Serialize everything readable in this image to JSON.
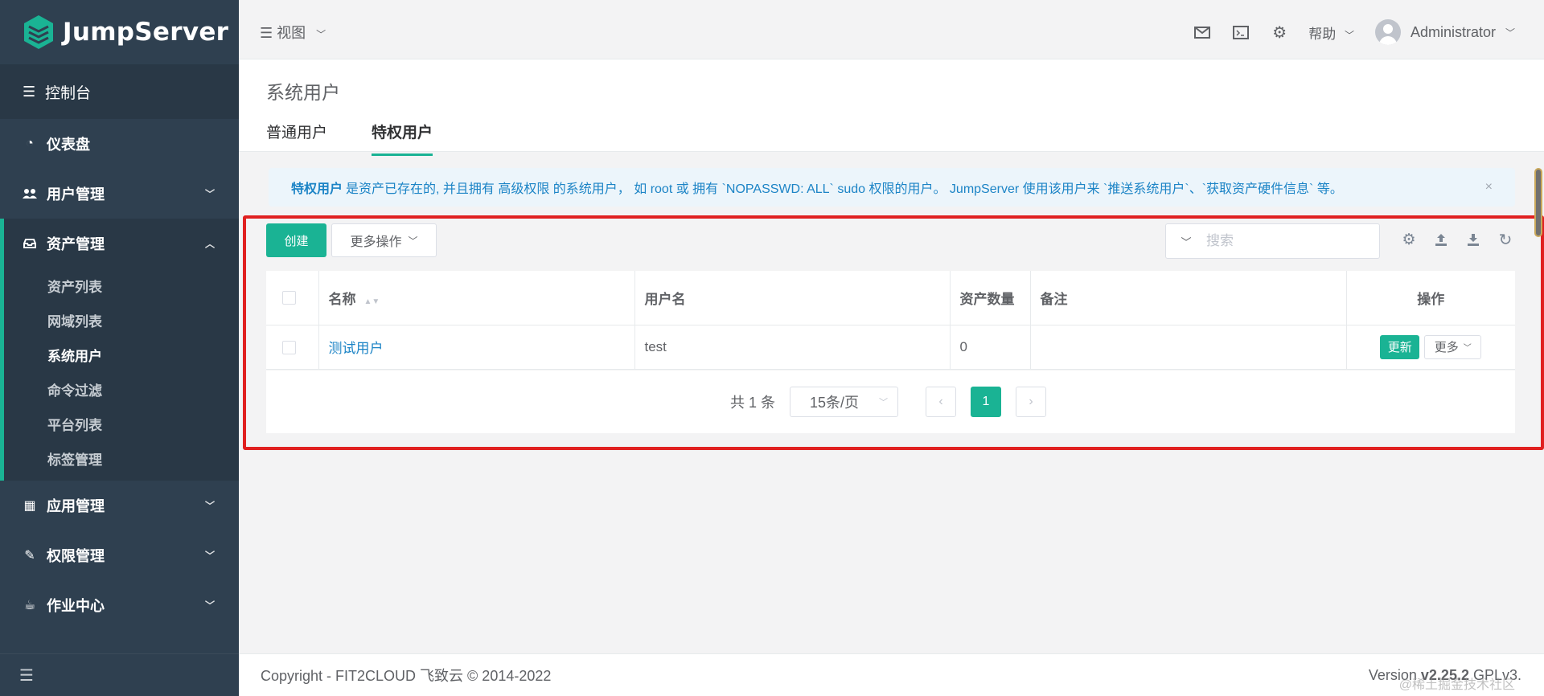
{
  "brand": {
    "name": "JumpServer"
  },
  "sidebar": {
    "console_label": "控制台",
    "items": [
      {
        "label": "仪表盘",
        "icon": "dashboard-icon"
      },
      {
        "label": "用户管理",
        "icon": "users-icon"
      },
      {
        "label": "资产管理",
        "icon": "inbox-icon"
      },
      {
        "label": "应用管理",
        "icon": "grid-icon"
      },
      {
        "label": "权限管理",
        "icon": "edit-icon"
      },
      {
        "label": "作业中心",
        "icon": "coffee-icon"
      }
    ],
    "sub_items": [
      "资产列表",
      "网域列表",
      "系统用户",
      "命令过滤",
      "平台列表",
      "标签管理"
    ]
  },
  "topbar": {
    "view_label": "视图",
    "help_label": "帮助",
    "user_name": "Administrator"
  },
  "page": {
    "title": "系统用户",
    "tabs": [
      "普通用户",
      "特权用户"
    ]
  },
  "alert": {
    "bold": "特权用户",
    "text": "是资产已存在的, 并且拥有 高级权限 的系统用户， 如 root 或 拥有 `NOPASSWD: ALL` sudo 权限的用户。 JumpServer 使用该用户来 `推送系统用户`、`获取资产硬件信息` 等。",
    "close": "×"
  },
  "toolbar": {
    "create_label": "创建",
    "more_label": "更多操作",
    "search_placeholder": "搜索"
  },
  "table": {
    "headers": [
      "名称",
      "用户名",
      "资产数量",
      "备注",
      "操作"
    ],
    "rows": [
      {
        "name": "测试用户",
        "username": "test",
        "asset_count": "0",
        "comment": "",
        "update_label": "更新",
        "more_label": "更多"
      }
    ]
  },
  "pagination": {
    "total": "共 1 条",
    "page_size": "15条/页",
    "current_page": "1"
  },
  "footer": {
    "copyright": "Copyright - FIT2CLOUD 飞致云 © 2014-2022",
    "version_prefix": "Version ",
    "version": "v2.25.2",
    "license": " GPLv3."
  },
  "watermark": "@稀土掘金技术社区",
  "colors": {
    "accent": "#1ab394",
    "sidebar": "#2f4050",
    "link": "#1c84c6",
    "highlight": "#e02020"
  }
}
